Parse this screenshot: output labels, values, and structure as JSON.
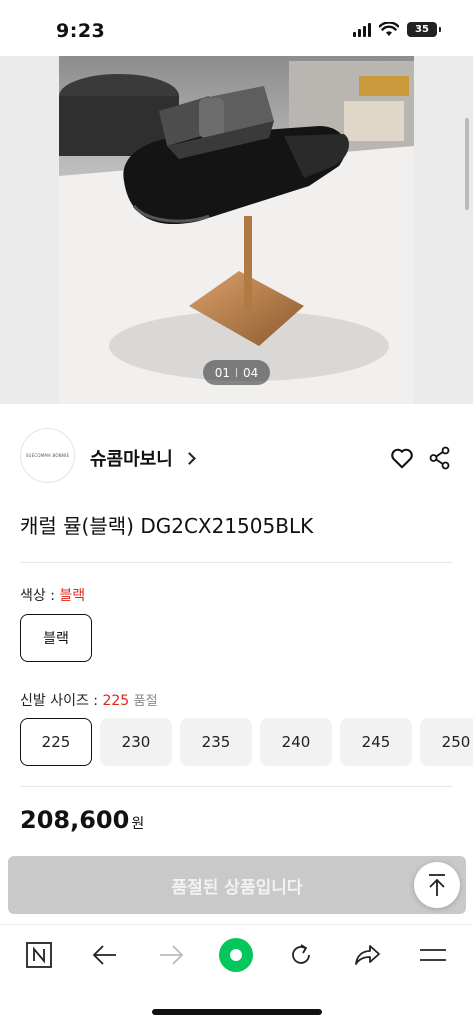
{
  "status_bar": {
    "time": "9:23",
    "battery": "35"
  },
  "gallery": {
    "current": "01",
    "total": "04"
  },
  "brand": {
    "name": "슈콤마보니",
    "logo_text": "SUECOMMA BONNIE"
  },
  "product": {
    "title": "캐럴 뮬(블랙) DG2CX21505BLK"
  },
  "color_option": {
    "label": "색상 : ",
    "selected": "블랙",
    "choices": [
      "블랙"
    ]
  },
  "size_option": {
    "label": "신발 사이즈 : ",
    "selected": "225",
    "status": "품절",
    "choices": [
      "225",
      "230",
      "235",
      "240",
      "245",
      "250"
    ]
  },
  "price": {
    "amount": "208,600",
    "unit": "원"
  },
  "purchase": {
    "soldout_label": "품절된 상품입니다"
  },
  "colors": {
    "accent_red": "#e0261b",
    "naver_green": "#03c75a"
  },
  "browser_nav": {
    "icons": [
      "naver-n-icon",
      "back-arrow-icon",
      "forward-arrow-icon",
      "home-green-dot-icon",
      "reload-icon",
      "share-arrow-icon",
      "menu-icon"
    ]
  }
}
